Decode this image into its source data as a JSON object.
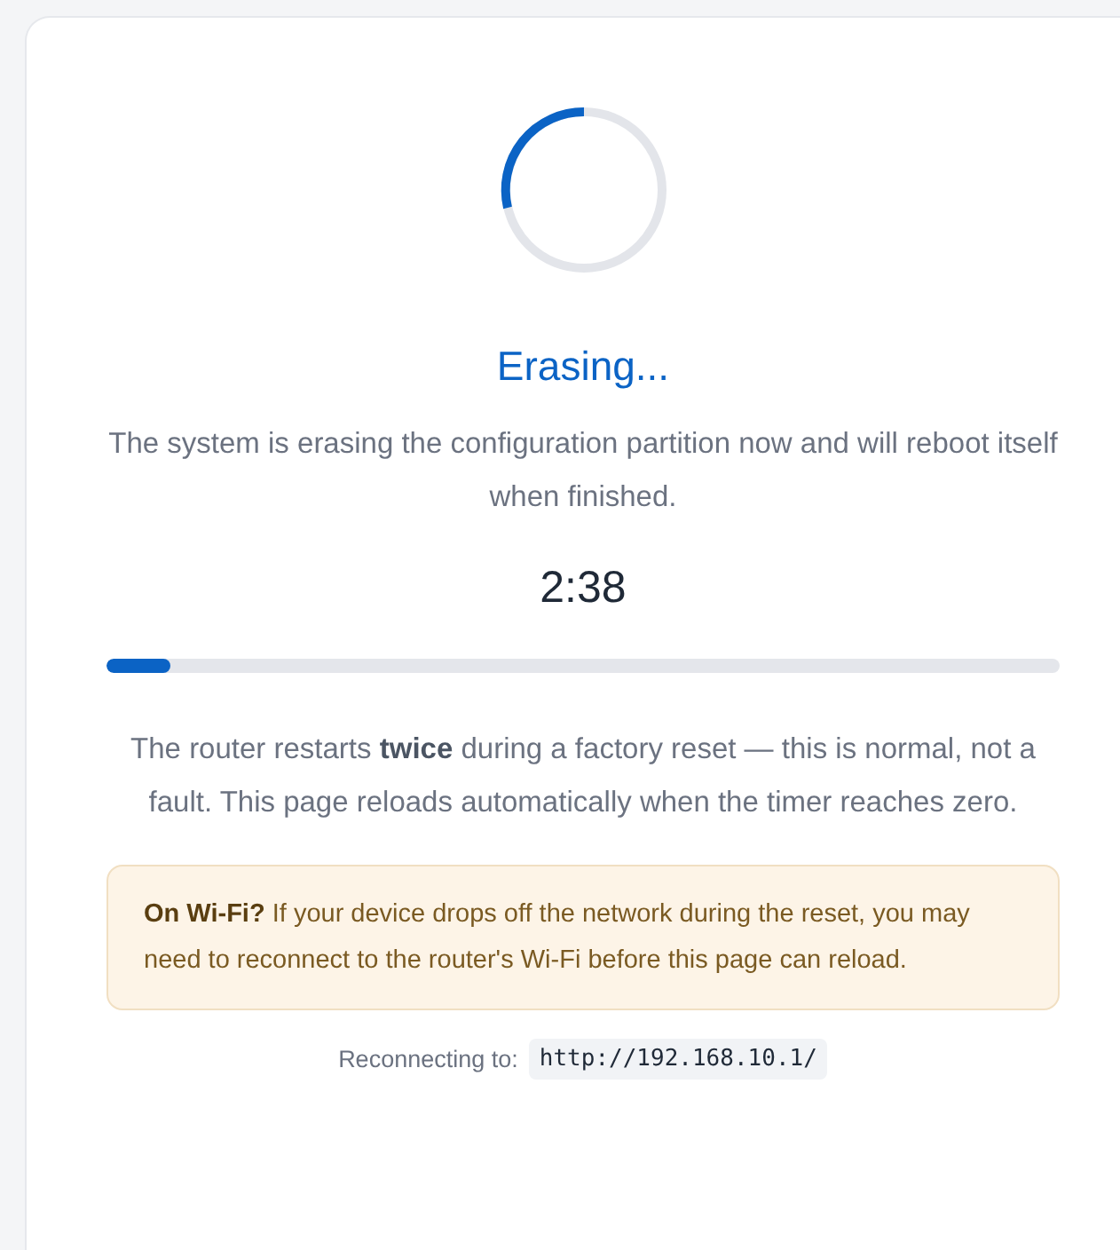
{
  "title": "Erasing...",
  "description": "The system is erasing the configuration partition now and will reboot itself when finished.",
  "timer": "2:38",
  "progress": {
    "level": 0.067
  },
  "note": "The router restarts **twice** during a factory reset — this is normal, not a fault. This page reloads automatically when the timer reaches zero.",
  "notice": "**On Wi-Fi?** If your device drops off the network during the reset, you may need to reconnect to the router's Wi-Fi before this page can reload.",
  "footer": {
    "label": "Reconnecting to:",
    "address": "http://192.168.10.1/"
  }
}
